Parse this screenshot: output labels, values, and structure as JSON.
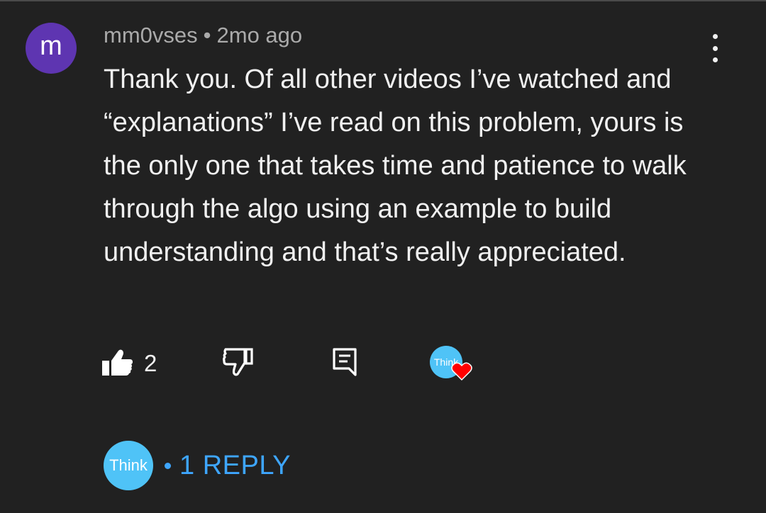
{
  "comment": {
    "avatar_letter": "m",
    "author": "mm0vses",
    "separator": "•",
    "time": "2mo ago",
    "text": "Thank you. Of all other videos I’ve watched and “explanations” I’ve read on this problem, yours is the only one that takes time and patience to walk through the algo using an example to build understanding and that’s really appreciated.",
    "like_count": "2",
    "creator_heart_avatar_text": "Think"
  },
  "replies": {
    "creator_avatar_text": "Think",
    "separator": "•",
    "label": "1 REPLY"
  },
  "icons": {
    "more": "more-vert-icon",
    "like": "thumb-up-icon",
    "dislike": "thumb-down-icon",
    "reply": "comment-reply-icon",
    "heart": "heart-icon"
  },
  "colors": {
    "background": "#212121",
    "avatar": "#5e35b1",
    "creator_avatar": "#4fc3f7",
    "link": "#3ea6ff",
    "heart": "#ff0000"
  }
}
